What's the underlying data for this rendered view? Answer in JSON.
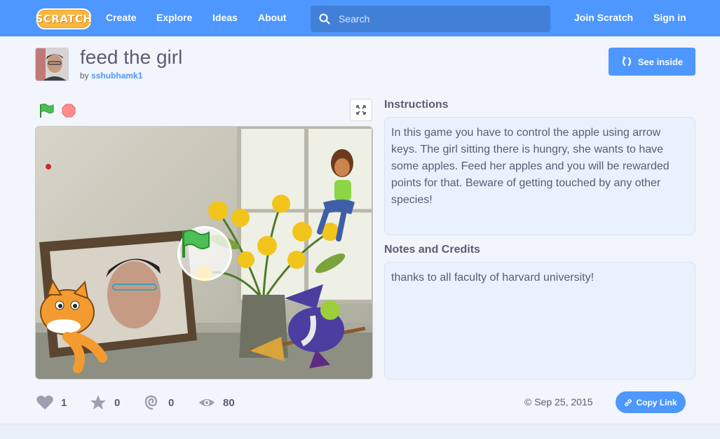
{
  "nav": {
    "logo": "SCRATCH",
    "links": [
      "Create",
      "Explore",
      "Ideas",
      "About"
    ],
    "search_placeholder": "Search",
    "join": "Join Scratch",
    "signin": "Sign in"
  },
  "project": {
    "title": "feed the girl",
    "by_label": "by",
    "author": "sshubhamk1",
    "see_inside": "See inside"
  },
  "instructions": {
    "heading": "Instructions",
    "text": "In this game you have to control the apple using arrow keys. The girl sitting there is hungry, she wants to have some apples. Feed her apples and you will be rewarded points for that. Beware of getting touched by any other species!"
  },
  "notes": {
    "heading": "Notes and Credits",
    "text": "thanks to all faculty of harvard university!"
  },
  "stats": {
    "loves": "1",
    "favorites": "0",
    "remixes": "0",
    "views": "80"
  },
  "footer": {
    "date_icon": "©",
    "date": "Sep 25, 2015",
    "copy_link": "Copy Link"
  },
  "colors": {
    "brand": "#4d97ff",
    "text": "#575e75",
    "panel": "#e9f1fc"
  }
}
